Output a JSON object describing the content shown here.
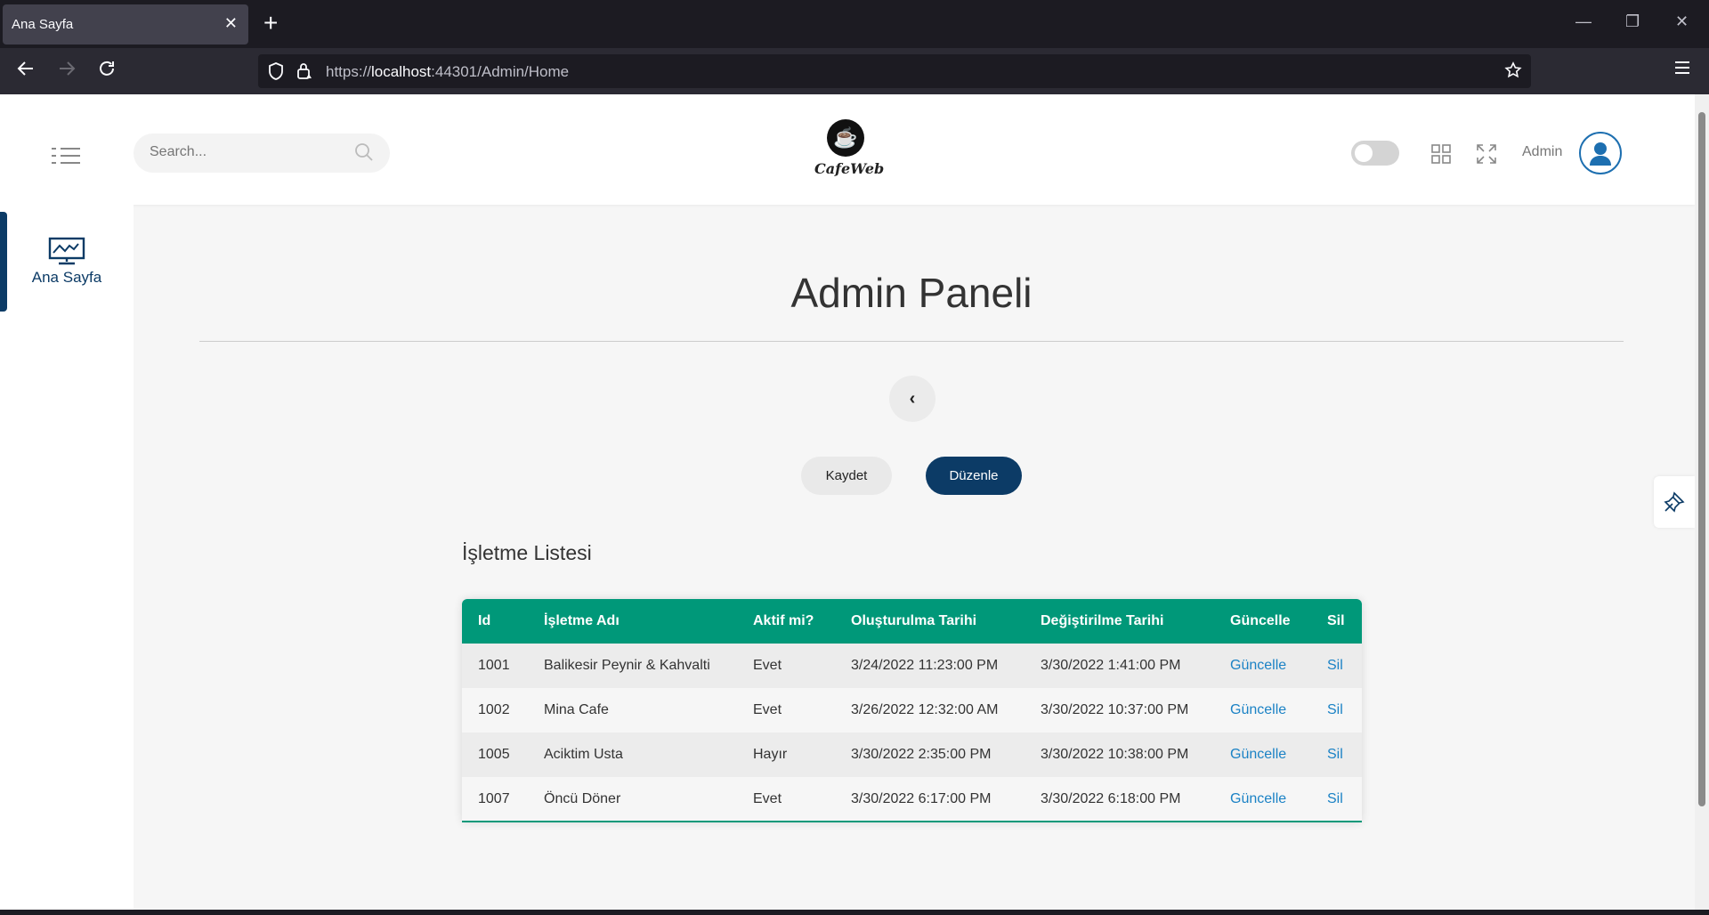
{
  "browser": {
    "tab_title": "Ana Sayfa",
    "tab_close": "✕",
    "new_tab": "+",
    "url_prefix": "https://",
    "url_host": "localhost",
    "url_rest": ":44301/Admin/Home"
  },
  "header": {
    "search_placeholder": "Search...",
    "brand": "CafeWeb",
    "user_name": "Admin"
  },
  "sidebar": {
    "items": [
      {
        "label": "Ana Sayfa",
        "icon": "monitor-chart-icon"
      }
    ]
  },
  "main": {
    "title": "Admin Paneli",
    "back_label": "‹",
    "save_label": "Kaydet",
    "edit_label": "Düzenle",
    "list_title": "İşletme Listesi"
  },
  "table": {
    "columns": [
      "Id",
      "İşletme Adı",
      "Aktif mi?",
      "Oluşturulma Tarihi",
      "Değiştirilme Tarihi",
      "Güncelle",
      "Sil"
    ],
    "rows": [
      {
        "id": "1001",
        "name": "Balikesir Peynir & Kahvalti",
        "active": "Evet",
        "created": "3/24/2022 11:23:00 PM",
        "modified": "3/30/2022 1:41:00 PM",
        "update": "Güncelle",
        "delete": "Sil"
      },
      {
        "id": "1002",
        "name": "Mina Cafe",
        "active": "Evet",
        "created": "3/26/2022 12:32:00 AM",
        "modified": "3/30/2022 10:37:00 PM",
        "update": "Güncelle",
        "delete": "Sil"
      },
      {
        "id": "1005",
        "name": "Aciktim Usta",
        "active": "Hayır",
        "created": "3/30/2022 2:35:00 PM",
        "modified": "3/30/2022 10:38:00 PM",
        "update": "Güncelle",
        "delete": "Sil"
      },
      {
        "id": "1007",
        "name": "Öncü Döner",
        "active": "Evet",
        "created": "3/30/2022 6:17:00 PM",
        "modified": "3/30/2022 6:18:00 PM",
        "update": "Güncelle",
        "delete": "Sil"
      }
    ]
  },
  "colors": {
    "accent": "#0c3b66",
    "table_header": "#009879",
    "link": "#1b82c5"
  }
}
